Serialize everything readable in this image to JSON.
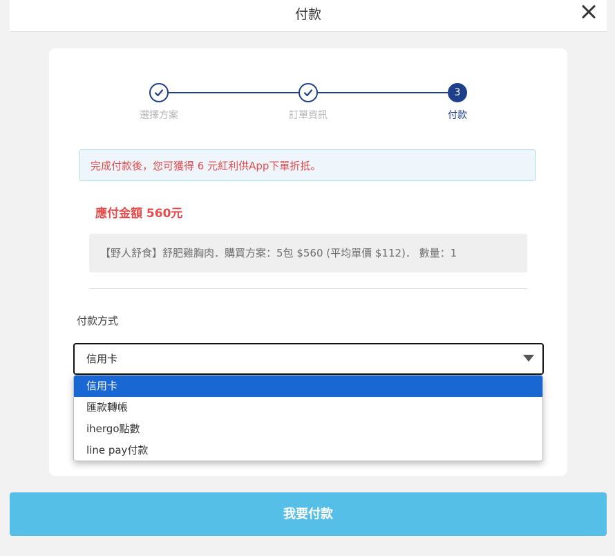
{
  "header": {
    "title": "付款",
    "close_icon": "close-icon"
  },
  "stepper": {
    "steps": [
      {
        "label": "選擇方案",
        "state": "done",
        "icon": "check-icon"
      },
      {
        "label": "訂單資訊",
        "state": "done",
        "icon": "check-icon"
      },
      {
        "label": "付款",
        "state": "active",
        "number": "3"
      }
    ],
    "active_color": "#1e3f8a",
    "inactive_label_color": "#b5b5b5"
  },
  "notice": {
    "text": "完成付款後，您可獲得 6 元紅利供App下單折抵。",
    "color": "#e34d4d"
  },
  "amount": {
    "text": "應付金額 560元"
  },
  "order_summary": {
    "text": "【野人舒食】舒肥雞胸肉．購買方案：5包 $560 (平均單價 $112)． 數量：1"
  },
  "payment_method": {
    "label": "付款方式",
    "selected": "信用卡",
    "options": [
      "信用卡",
      "匯款轉帳",
      "ihergo點數",
      "line pay付款"
    ]
  },
  "pay_button": {
    "label": "我要付款",
    "color": "#55bfe8"
  }
}
